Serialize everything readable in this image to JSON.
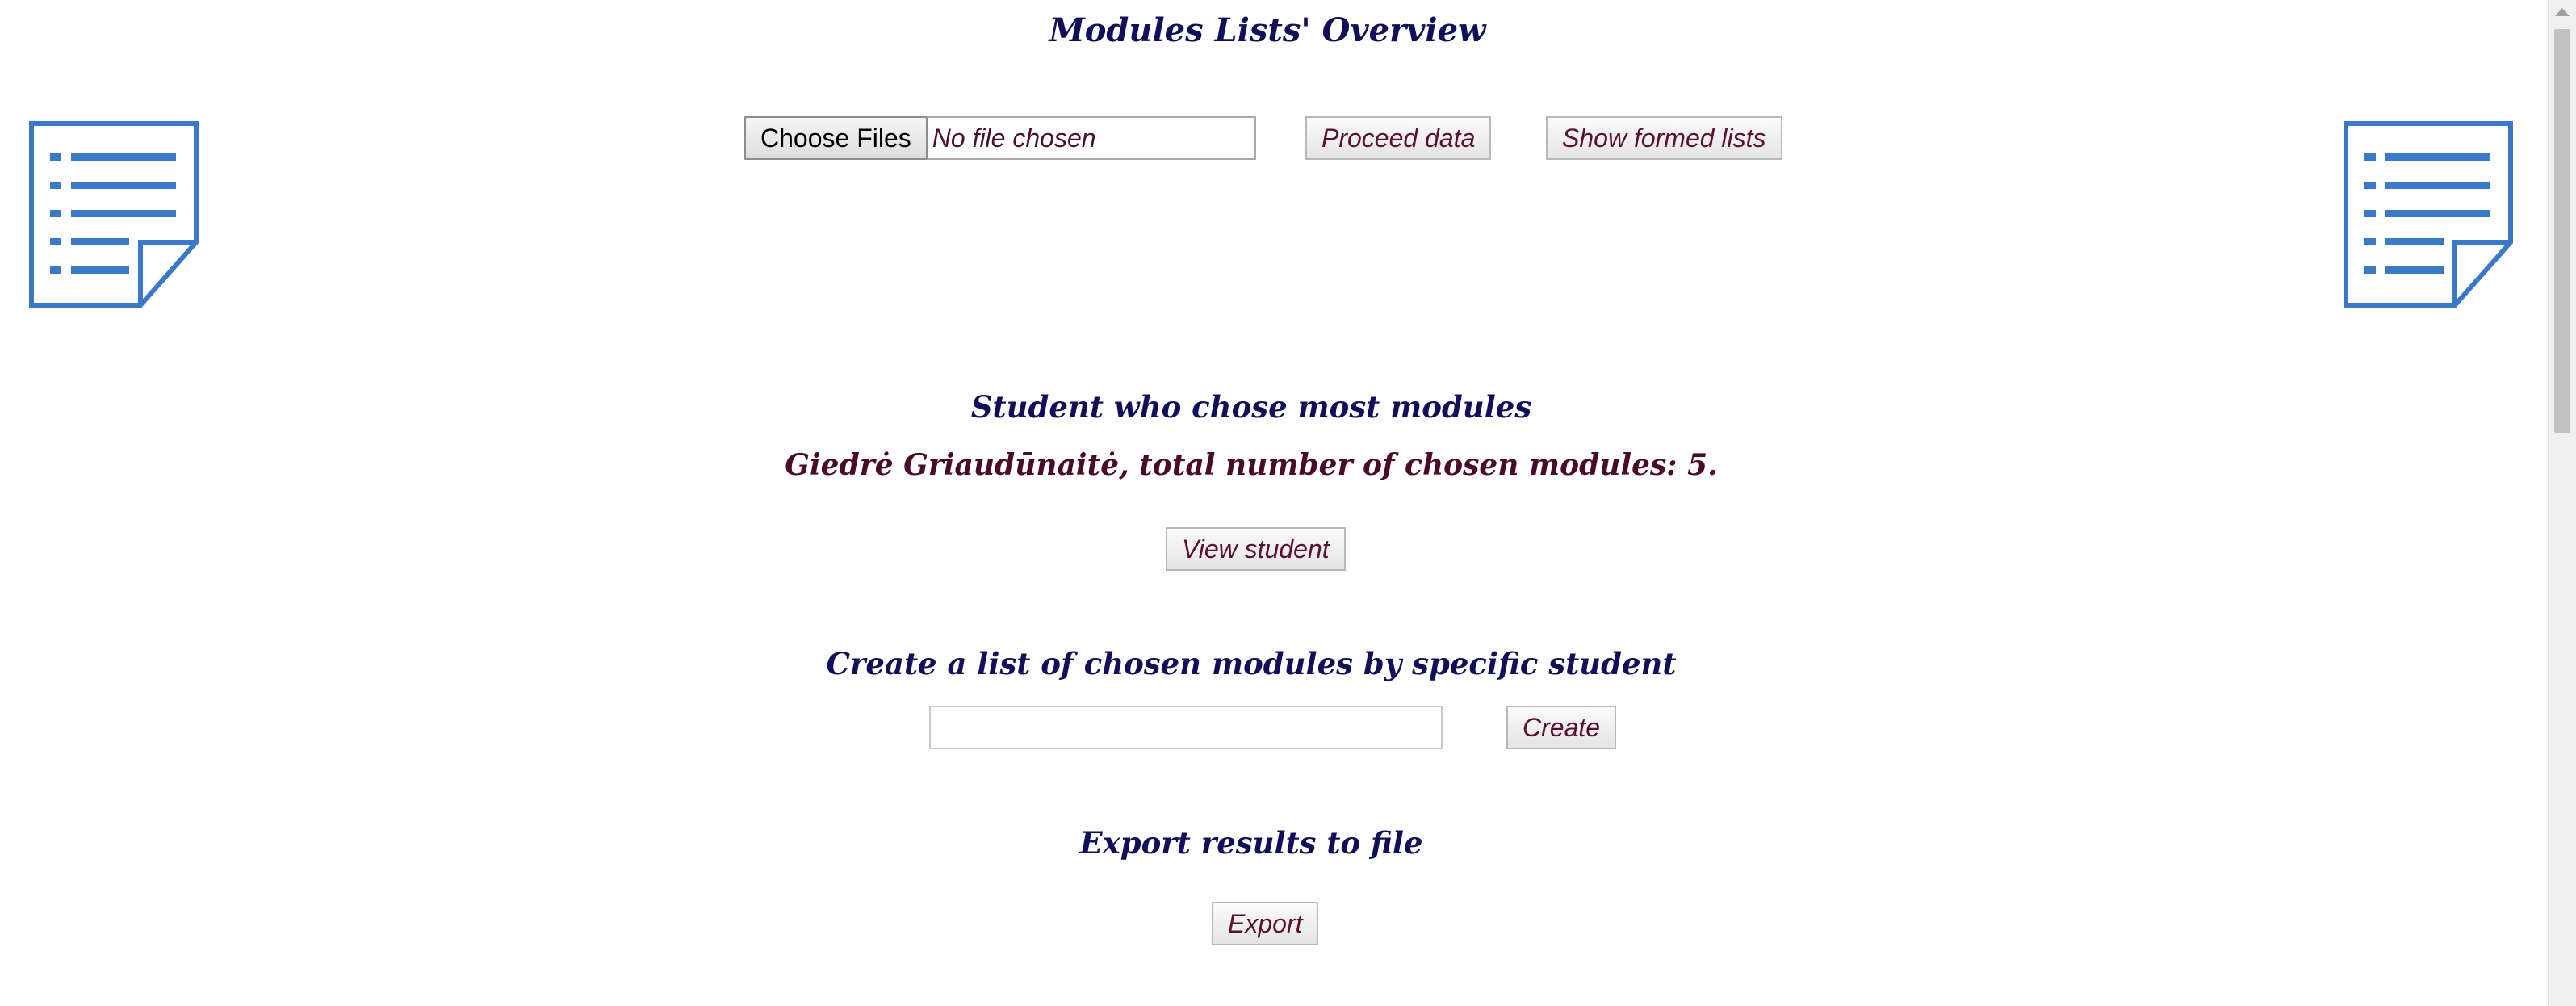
{
  "page": {
    "title": "Modules Lists' Overview"
  },
  "toolbar": {
    "choose_files_label": "Choose Files",
    "file_status": "No file chosen",
    "proceed_label": "Proceed data",
    "show_lists_label": "Show formed lists"
  },
  "top_student": {
    "heading": "Student who chose most modules",
    "result": "Giedrė Griaudūnaitė, total number of chosen modules: 5.",
    "view_label": "View student"
  },
  "create_list": {
    "heading": "Create a list of chosen modules by specific student",
    "input_value": "",
    "input_placeholder": "",
    "create_label": "Create"
  },
  "export": {
    "heading": "Export results to file",
    "export_label": "Export"
  },
  "icons": {
    "left": "document-list-icon",
    "right": "document-list-icon",
    "color": "#3a78c8"
  },
  "colors": {
    "heading": "#10105a",
    "result_text": "#4a0a2a",
    "button_text": "#5a1030"
  }
}
